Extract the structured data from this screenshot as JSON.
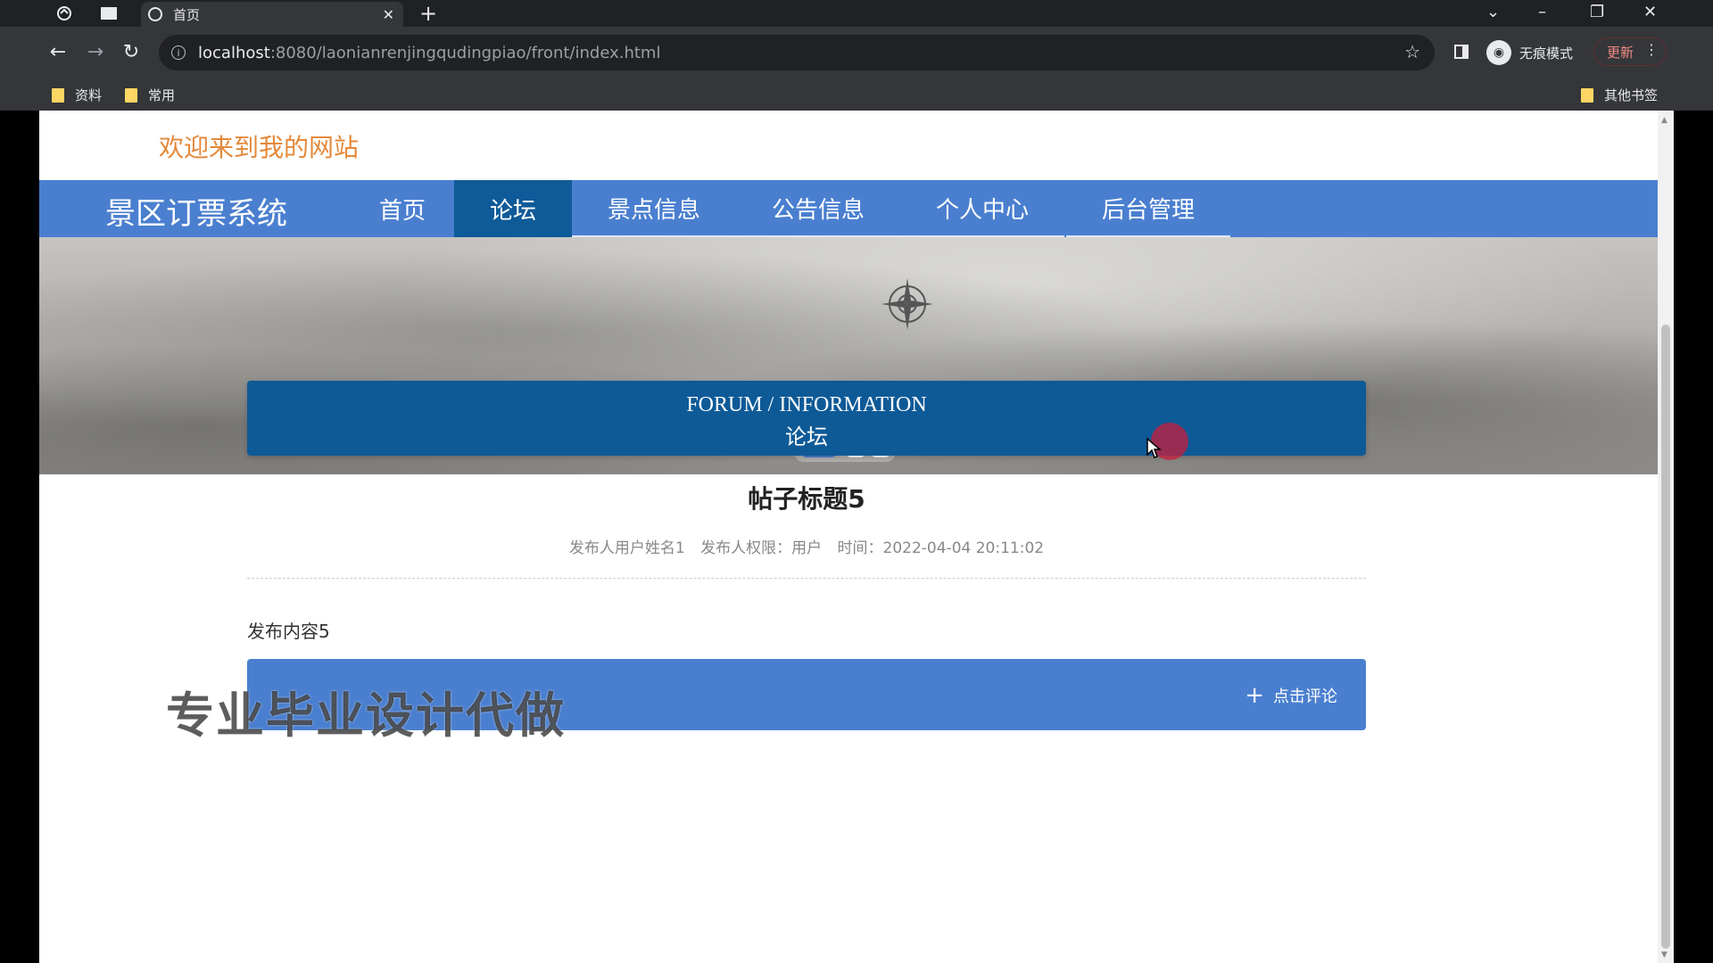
{
  "browser": {
    "tab_title": "首页",
    "url_host": "localhost",
    "url_rest": ":8080/laonianrenjingqudingpiao/front/index.html",
    "incognito_label": "无痕模式",
    "update_label": "更新",
    "bookmarks": [
      "资料",
      "常用"
    ],
    "other_bookmarks": "其他书签"
  },
  "site": {
    "welcome": "欢迎来到我的网站",
    "brand": "景区订票系统",
    "nav": [
      "首页",
      "论坛",
      "景点信息",
      "公告信息",
      "个人中心",
      "后台管理"
    ],
    "active_nav": "论坛"
  },
  "section": {
    "title_en": "FORUM / INFORMATION",
    "title_zh": "论坛"
  },
  "post": {
    "title": "帖子标题5",
    "author": "发布人用户姓名1",
    "role": "发布人权限：用户",
    "time": "时间：2022-04-04 20:11:02",
    "content": "发布内容5",
    "comment_label": "点击评论"
  },
  "watermark": "专业毕业设计代做",
  "colors": {
    "nav_bg": "#4a7fd0",
    "nav_active": "#0f5a98",
    "section_bg": "#0e5a97",
    "welcome_text": "#e4893a"
  }
}
